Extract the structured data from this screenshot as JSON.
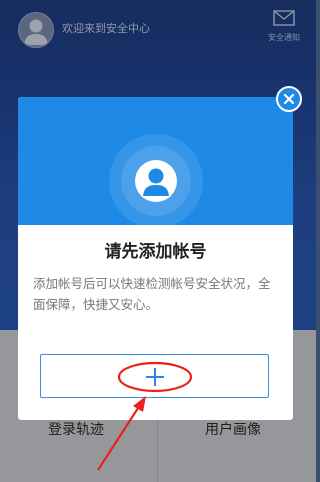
{
  "header": {
    "welcome_text": "欢迎来到安全中心",
    "notify_label": "安全通知",
    "notify_icon": "envelope-icon",
    "avatar_icon": "user-avatar-icon"
  },
  "dialog": {
    "title": "请先添加帐号",
    "description": "添加帐号后可以快速检测帐号安全状况，全面保障，快捷又安心。",
    "add_icon": "plus-icon",
    "close_icon": "close-icon",
    "accent_color": "#1f8ae6"
  },
  "tiles": {
    "left_label": "登录轨迹",
    "right_label": "用户画像"
  },
  "annotation": {
    "color": "#e8231d",
    "shapes": [
      "circle-highlight",
      "arrow"
    ]
  }
}
